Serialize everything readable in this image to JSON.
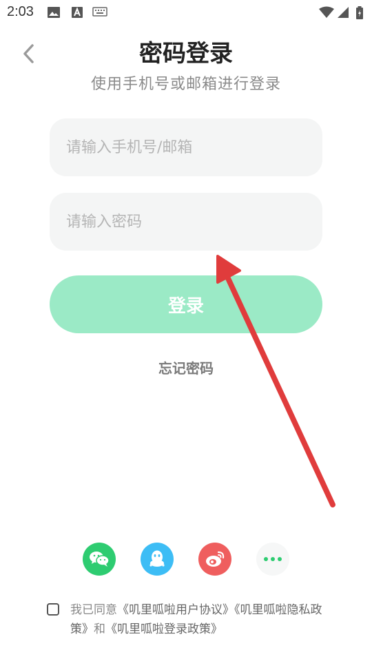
{
  "status_bar": {
    "time": "2:03",
    "icons": [
      "image-icon",
      "text-a-icon",
      "keyboard-icon",
      "wifi-icon",
      "signal-icon",
      "signal-icon",
      "battery-charging-icon"
    ]
  },
  "header": {
    "back_icon": "chevron-left-icon",
    "title": "密码登录",
    "subtitle": "使用手机号或邮箱进行登录"
  },
  "form": {
    "account_placeholder": "请输入手机号/邮箱",
    "account_value": "",
    "password_placeholder": "请输入密码",
    "password_value": "",
    "login_label": "登录",
    "forgot_label": "忘记密码"
  },
  "social": {
    "items": [
      {
        "name": "wechat",
        "icon": "wechat-icon",
        "color": "#2ecc71"
      },
      {
        "name": "qq",
        "icon": "qq-icon",
        "color": "#3dbdf5"
      },
      {
        "name": "weibo",
        "icon": "weibo-icon",
        "color": "#ef5e5e"
      },
      {
        "name": "more",
        "icon": "more-dots-icon",
        "color": "#2ecc71"
      }
    ]
  },
  "agreement": {
    "prefix": "我已同意",
    "user_agreement": "《叽里呱啦用户协议》",
    "privacy_policy": "《叽里呱啦隐私政策》",
    "conjunction": "和",
    "login_policy": "《叽里呱啦登录政策》",
    "checked": false
  },
  "colors": {
    "accent": "#9beac6",
    "annotation_arrow": "#e03c3c"
  }
}
